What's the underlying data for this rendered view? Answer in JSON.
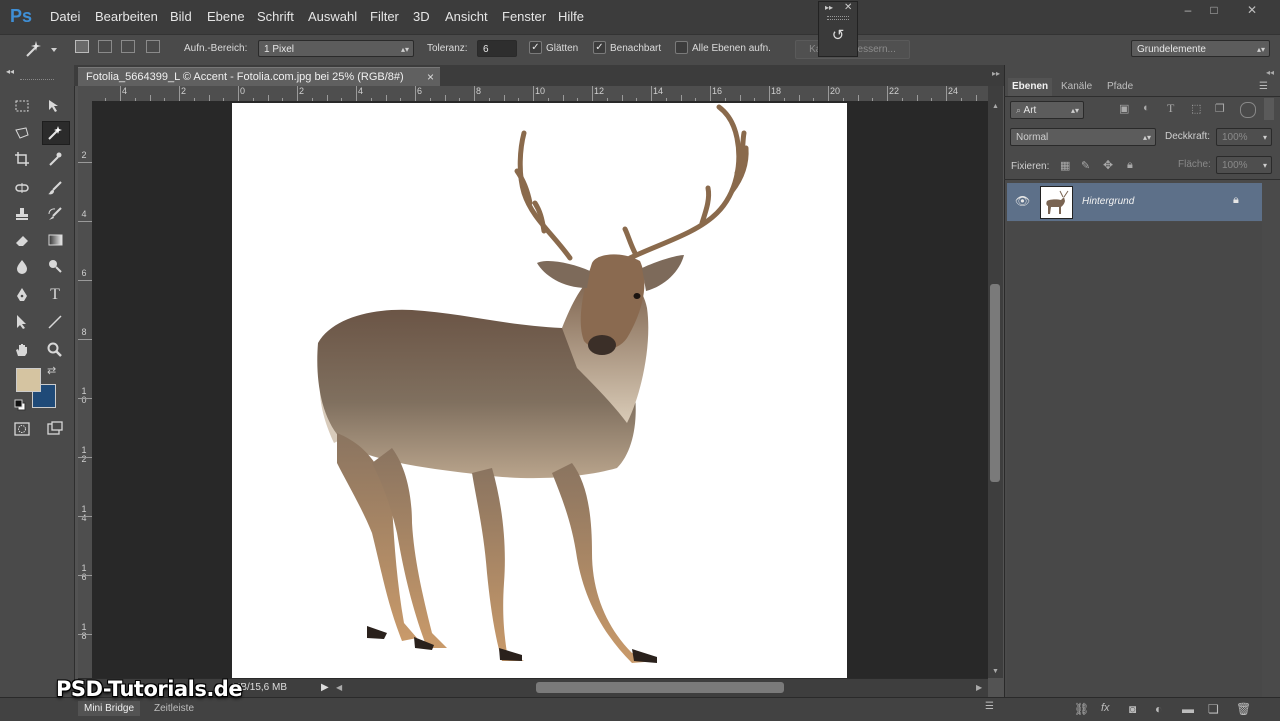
{
  "app": {
    "logo": "Ps"
  },
  "menu": [
    "Datei",
    "Bearbeiten",
    "Bild",
    "Ebene",
    "Schrift",
    "Auswahl",
    "Filter",
    "3D",
    "Ansicht",
    "Fenster",
    "Hilfe"
  ],
  "window_controls": {
    "minimize": "–",
    "restore": "□",
    "close": "✕"
  },
  "options": {
    "sample_label": "Aufn.-Bereich:",
    "sample_value": "1 Pixel",
    "tolerance_label": "Toleranz:",
    "tolerance_value": "6",
    "antialias_label": "Glätten",
    "antialias_checked": true,
    "contiguous_label": "Benachbart",
    "contiguous_checked": true,
    "all_layers_label": "Alle Ebenen aufn.",
    "all_layers_checked": false,
    "refine_edge_button": "Kante verbessern...",
    "workspace_value": "Grundelemente"
  },
  "document": {
    "tab_title": "Fotolia_5664399_L © Accent - Fotolia.com.jpg bei 25% (RGB/8#)",
    "close_glyph": "×",
    "status_text": "MB/15,6 MB"
  },
  "ruler_top_labels": [
    "4",
    "2",
    "0",
    "2",
    "4",
    "6",
    "8",
    "10",
    "12",
    "14",
    "16",
    "18",
    "20",
    "22",
    "24"
  ],
  "ruler_left_labels": [
    "2",
    "4",
    "6",
    "8",
    "1 0",
    "1 2",
    "1 4",
    "1 6",
    "1 8"
  ],
  "colors": {
    "foreground": "#d5c4a1",
    "background": "#1f4a78",
    "selection": "#5d7089"
  },
  "bottom_tabs": {
    "mini_bridge": "Mini Bridge",
    "timeline": "Zeitleiste"
  },
  "layers_panel": {
    "tabs": [
      "Ebenen",
      "Kanäle",
      "Pfade"
    ],
    "filter_kind": "Art",
    "blend_mode": "Normal",
    "opacity_label": "Deckkraft:",
    "opacity_value": "100%",
    "lock_label": "Fixieren:",
    "fill_label": "Fläche:",
    "fill_value": "100%",
    "layers": [
      {
        "name": "Hintergrund",
        "visible": true,
        "locked": true
      }
    ]
  },
  "watermark": "PSD-Tutorials.de"
}
